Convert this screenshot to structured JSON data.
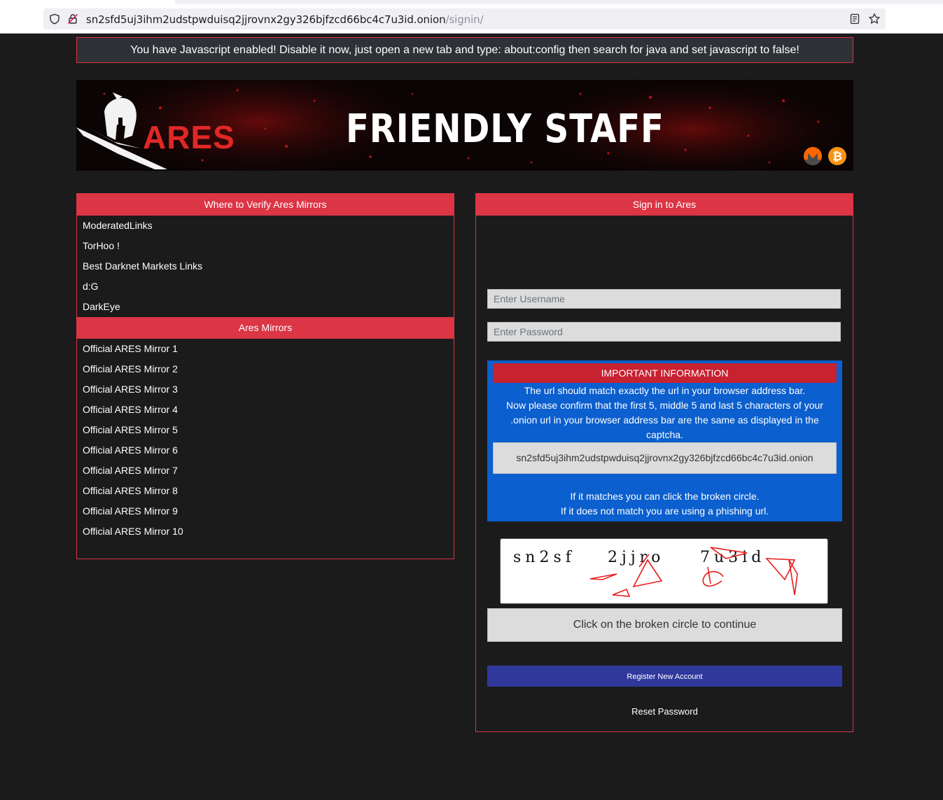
{
  "browser": {
    "url_host": "sn2sfd5uj3ihm2udstpwduisq2jjrovnx2gy326bjfzcd66bc4c7u3id.onion",
    "url_path": "/signin/"
  },
  "warning": {
    "text": "You have Javascript enabled! Disable it now, just open a new tab and type: about:config then search for java and set javascript to false!"
  },
  "banner": {
    "logo_text": "ARES",
    "title": "FRIENDLY STAFF",
    "monero_icon": "monero-icon",
    "bitcoin_icon": "bitcoin-icon"
  },
  "verify_panel": {
    "header": "Where to Verify Ares Mirrors",
    "links": [
      "ModeratedLinks",
      "TorHoo !",
      "Best Darknet Markets Links",
      "d:G",
      "DarkEye"
    ],
    "mirrors_header": "Ares Mirrors",
    "mirrors": [
      "Official ARES Mirror 1",
      "Official ARES Mirror 2",
      "Official ARES Mirror 3",
      "Official ARES Mirror 4",
      "Official ARES Mirror 5",
      "Official ARES Mirror 6",
      "Official ARES Mirror 7",
      "Official ARES Mirror 8",
      "Official ARES Mirror 9",
      "Official ARES Mirror 10"
    ]
  },
  "signin": {
    "header": "Sign in to Ares",
    "username_placeholder": "Enter Username",
    "password_placeholder": "Enter Password",
    "info_title": "IMPORTANT INFORMATION",
    "info_line1": "The url should match exactly the url in your browser address bar.",
    "info_line2": "Now please confirm that the first 5, middle 5 and last 5 characters of your .onion url in your browser address bar are the same as displayed in the captcha.",
    "onion_url": "sn2sfd5uj3ihm2udstpwduisq2jjrovnx2gy326bjfzcd66bc4c7u3id.onion",
    "info_line3": "If it matches you can click the broken circle.",
    "info_line4": "If it does not match you are using a phishing url.",
    "captcha_parts": [
      "sn2sf",
      "2jjro",
      "7u3id"
    ],
    "continue_label": "Click on the broken circle to continue",
    "register_label": "Register New Account",
    "reset_label": "Reset Password"
  },
  "colors": {
    "accent_red": "#dc3545",
    "info_blue": "#0b5fce",
    "register_blue": "#30389c",
    "background": "#1b1b1c"
  }
}
